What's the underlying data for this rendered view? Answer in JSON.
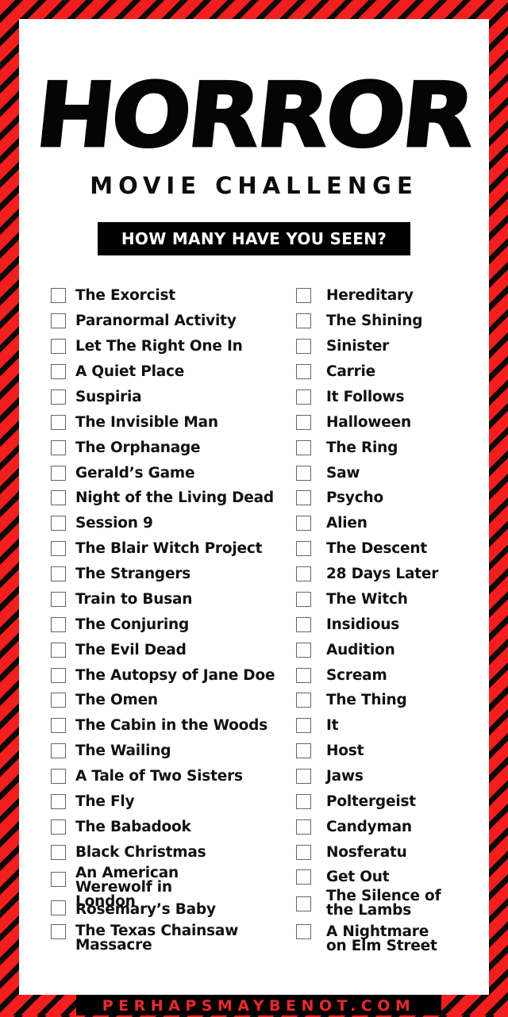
{
  "header": {
    "title": "HORROR",
    "subtitle": "MOVIE CHALLENGE",
    "tagline": "HOW MANY HAVE YOU SEEN?"
  },
  "colors": {
    "stripe_red": "#f51e1e",
    "stripe_black": "#0a0a0a",
    "panel": "#ffffff",
    "footer_text": "#e8292c"
  },
  "checklist": {
    "left": [
      {
        "title": "The Exorcist",
        "checked": false
      },
      {
        "title": "Paranormal Activity",
        "checked": false
      },
      {
        "title": "Let The Right One In",
        "checked": false
      },
      {
        "title": "A Quiet Place",
        "checked": false
      },
      {
        "title": "Suspiria",
        "checked": false
      },
      {
        "title": "The Invisible Man",
        "checked": false
      },
      {
        "title": "The Orphanage",
        "checked": false
      },
      {
        "title": "Gerald’s Game",
        "checked": false
      },
      {
        "title": "Night of the Living Dead",
        "checked": false
      },
      {
        "title": "Session 9",
        "checked": false
      },
      {
        "title": "The Blair Witch Project",
        "checked": false
      },
      {
        "title": "The Strangers",
        "checked": false
      },
      {
        "title": "Train to Busan",
        "checked": false
      },
      {
        "title": "The Conjuring",
        "checked": false
      },
      {
        "title": "The Evil Dead",
        "checked": false
      },
      {
        "title": "The Autopsy of Jane Doe",
        "checked": false
      },
      {
        "title": "The Omen",
        "checked": false
      },
      {
        "title": "The Cabin in the Woods",
        "checked": false
      },
      {
        "title": "The Wailing",
        "checked": false
      },
      {
        "title": "A Tale of Two Sisters",
        "checked": false
      },
      {
        "title": "The Fly",
        "checked": false
      },
      {
        "title": "The Babadook",
        "checked": false
      },
      {
        "title": "Black Christmas",
        "checked": false
      },
      {
        "title": "An American Werewolf in London",
        "checked": false
      },
      {
        "title": "Rosemary’s Baby",
        "checked": false
      },
      {
        "title": "The Texas Chainsaw Massacre",
        "checked": false
      }
    ],
    "right": [
      {
        "title": "Hereditary",
        "checked": false
      },
      {
        "title": "The Shining",
        "checked": false
      },
      {
        "title": "Sinister",
        "checked": false
      },
      {
        "title": "Carrie",
        "checked": false
      },
      {
        "title": "It Follows",
        "checked": false
      },
      {
        "title": "Halloween",
        "checked": false
      },
      {
        "title": "The Ring",
        "checked": false
      },
      {
        "title": "Saw",
        "checked": false
      },
      {
        "title": "Psycho",
        "checked": false
      },
      {
        "title": "Alien",
        "checked": false
      },
      {
        "title": "The Descent",
        "checked": false
      },
      {
        "title": "28 Days Later",
        "checked": false
      },
      {
        "title": "The Witch",
        "checked": false
      },
      {
        "title": "Insidious",
        "checked": false
      },
      {
        "title": "Audition",
        "checked": false
      },
      {
        "title": "Scream",
        "checked": false
      },
      {
        "title": "The Thing",
        "checked": false
      },
      {
        "title": "It",
        "checked": false
      },
      {
        "title": "Host",
        "checked": false
      },
      {
        "title": "Jaws",
        "checked": false
      },
      {
        "title": "Poltergeist",
        "checked": false
      },
      {
        "title": "Candyman",
        "checked": false
      },
      {
        "title": "Nosferatu",
        "checked": false
      },
      {
        "title": "Get Out",
        "checked": false
      },
      {
        "title": "The Silence of the Lambs",
        "checked": false
      },
      {
        "title": "A Nightmare on Elm Street",
        "checked": false
      }
    ]
  },
  "footer": {
    "site": "PERHAPSMAYBENOT.COM"
  }
}
